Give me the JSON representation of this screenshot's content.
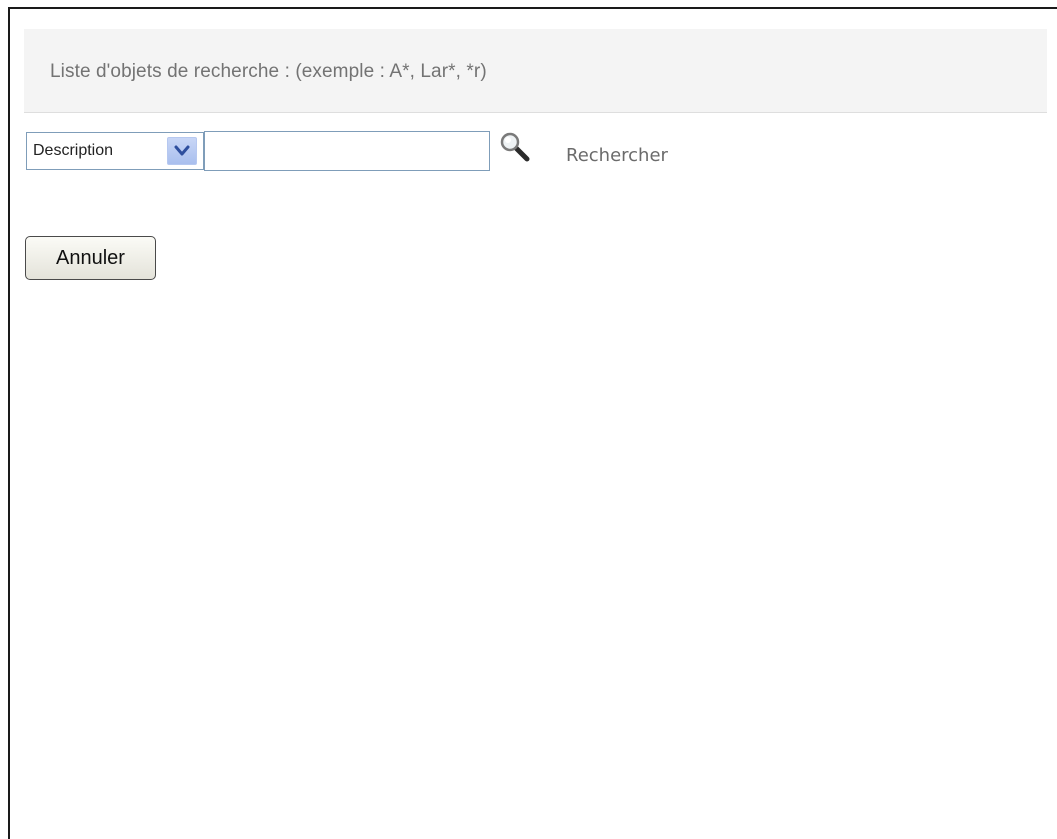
{
  "header": {
    "text": "Liste d'objets de recherche : (exemple : A*, Lar*, *r)"
  },
  "search": {
    "attribute_select_value": "Description",
    "input_value": "",
    "search_icon": "magnifier-icon",
    "search_link_label": "Rechercher"
  },
  "actions": {
    "cancel_label": "Annuler"
  },
  "colors": {
    "header_background": "#f4f4f4",
    "header_text": "#737373",
    "input_border": "#7f9db9",
    "link_text": "#6b6b6b"
  }
}
